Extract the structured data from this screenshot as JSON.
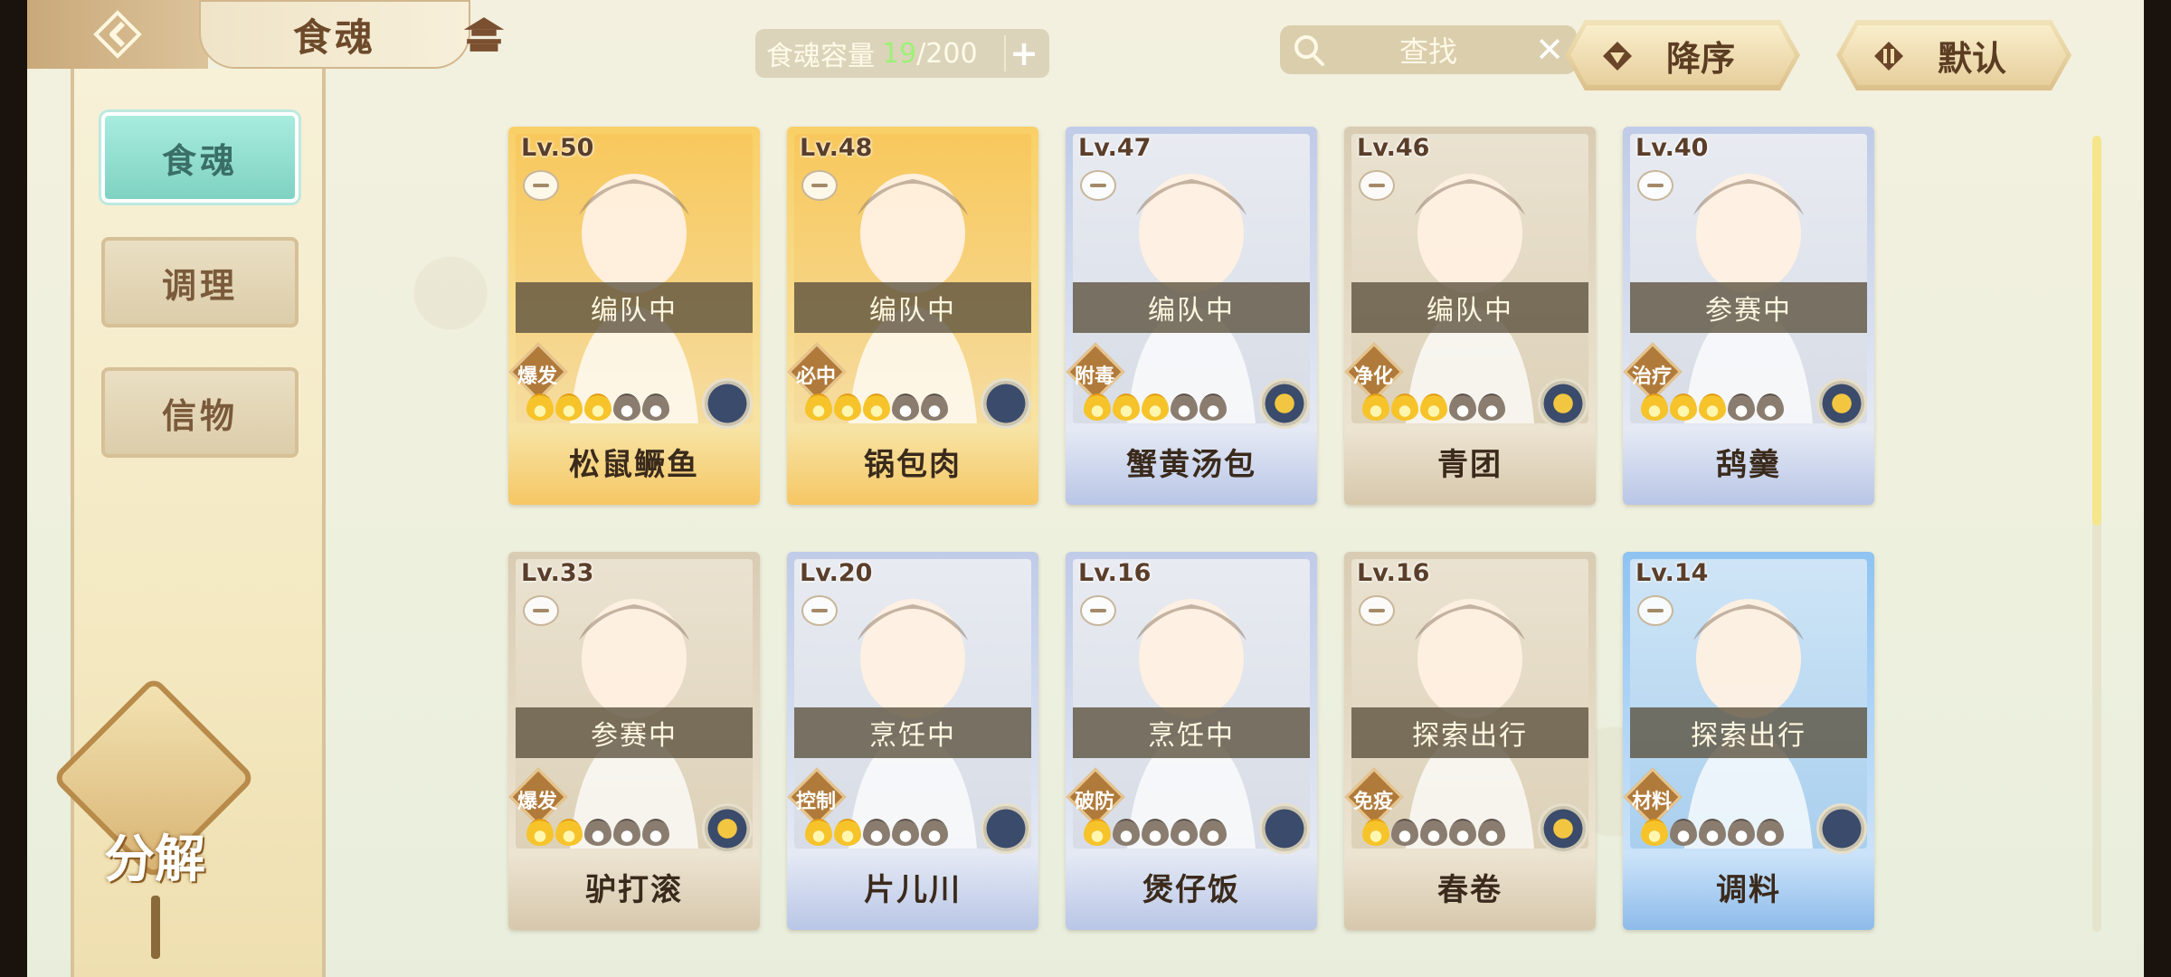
{
  "header": {
    "title": "食魂",
    "capacity_label": "食魂容量",
    "capacity_current": "19",
    "capacity_max": "/200",
    "capacity_plus": "+",
    "search_placeholder": "查找",
    "sort_order": "降序",
    "sort_mode": "默认"
  },
  "sidebar": {
    "tabs": [
      "食魂",
      "调理",
      "信物"
    ],
    "decompose": "分解"
  },
  "cards": [
    {
      "level": "Lv.50",
      "status": "编队中",
      "role": "爆发",
      "stars": 3,
      "name": "松鼠鳜鱼",
      "rarity": "gold",
      "flower": "blue"
    },
    {
      "level": "Lv.48",
      "status": "编队中",
      "role": "必中",
      "stars": 3,
      "name": "锅包肉",
      "rarity": "gold",
      "flower": "blue"
    },
    {
      "level": "Lv.47",
      "status": "编队中",
      "role": "附毒",
      "stars": 3,
      "name": "蟹黄汤包",
      "rarity": "blue",
      "flower": "gold"
    },
    {
      "level": "Lv.46",
      "status": "编队中",
      "role": "净化",
      "stars": 3,
      "name": "青团",
      "rarity": "tan",
      "flower": "gold"
    },
    {
      "level": "Lv.40",
      "status": "参赛中",
      "role": "治疗",
      "stars": 3,
      "name": "鸹羹",
      "rarity": "blue",
      "flower": "gold"
    },
    {
      "level": "Lv.33",
      "status": "参赛中",
      "role": "爆发",
      "stars": 2,
      "name": "驴打滚",
      "rarity": "tan",
      "flower": "gold"
    },
    {
      "level": "Lv.20",
      "status": "烹饪中",
      "role": "控制",
      "stars": 2,
      "name": "片儿川",
      "rarity": "blue",
      "flower": "blue"
    },
    {
      "level": "Lv.16",
      "status": "烹饪中",
      "role": "破防",
      "stars": 1,
      "name": "煲仔饭",
      "rarity": "blue",
      "flower": "blue"
    },
    {
      "level": "Lv.16",
      "status": "探索出行",
      "role": "免疫",
      "stars": 1,
      "name": "春卷",
      "rarity": "tan",
      "flower": "gold"
    },
    {
      "level": "Lv.14",
      "status": "探索出行",
      "role": "材料",
      "stars": 1,
      "name": "调料",
      "rarity": "sky",
      "flower": "blue"
    }
  ],
  "scroll": {
    "thumb_fraction": 0.49
  },
  "colors": {
    "accent_teal": "#8fdccc",
    "capacity_green": "#9ef07a",
    "frame_gold": "#d8c29a"
  },
  "icons": [
    "back-arrow-icon",
    "pavilion-icon",
    "search-icon",
    "close-icon",
    "triangle-down-icon",
    "sort-toggle-icon",
    "lock-icon",
    "flame-icon",
    "flower-icon"
  ]
}
